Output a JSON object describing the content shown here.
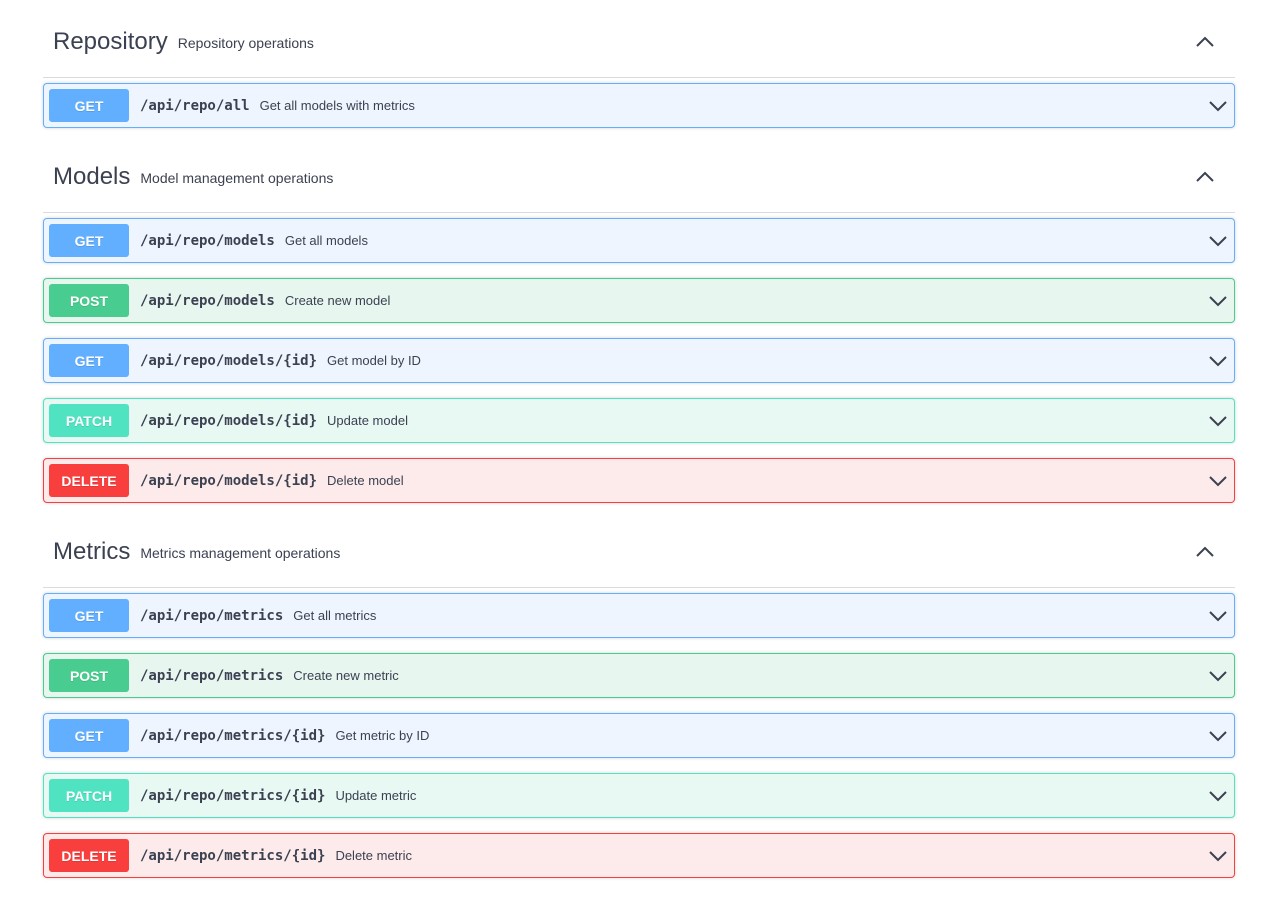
{
  "sections": [
    {
      "title": "Repository",
      "description": "Repository operations",
      "operations": [
        {
          "method": "GET",
          "path": "/api/repo/all",
          "summary": "Get all models with metrics"
        }
      ]
    },
    {
      "title": "Models",
      "description": "Model management operations",
      "operations": [
        {
          "method": "GET",
          "path": "/api/repo/models",
          "summary": "Get all models"
        },
        {
          "method": "POST",
          "path": "/api/repo/models",
          "summary": "Create new model"
        },
        {
          "method": "GET",
          "path": "/api/repo/models/{id}",
          "summary": "Get model by ID"
        },
        {
          "method": "PATCH",
          "path": "/api/repo/models/{id}",
          "summary": "Update model"
        },
        {
          "method": "DELETE",
          "path": "/api/repo/models/{id}",
          "summary": "Delete model"
        }
      ]
    },
    {
      "title": "Metrics",
      "description": "Metrics management operations",
      "operations": [
        {
          "method": "GET",
          "path": "/api/repo/metrics",
          "summary": "Get all metrics"
        },
        {
          "method": "POST",
          "path": "/api/repo/metrics",
          "summary": "Create new metric"
        },
        {
          "method": "GET",
          "path": "/api/repo/metrics/{id}",
          "summary": "Get metric by ID"
        },
        {
          "method": "PATCH",
          "path": "/api/repo/metrics/{id}",
          "summary": "Update metric"
        },
        {
          "method": "DELETE",
          "path": "/api/repo/metrics/{id}",
          "summary": "Delete metric"
        }
      ]
    }
  ],
  "icons": {
    "section_toggle": "chevron-up-icon",
    "operation_toggle": "chevron-down-icon"
  },
  "colors": {
    "GET": "#61affe",
    "POST": "#49cc90",
    "PATCH": "#50e3c2",
    "DELETE": "#f93e3e"
  }
}
